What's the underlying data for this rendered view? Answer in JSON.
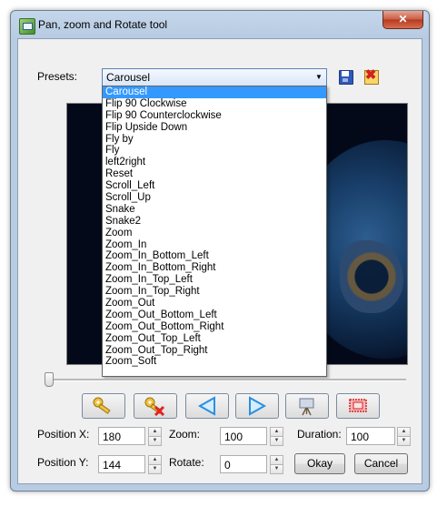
{
  "window": {
    "title": "Pan, zoom and Rotate tool",
    "close_label": "✕"
  },
  "presets": {
    "label": "Presets:",
    "selected": "Carousel",
    "save_icon": "floppy-disk-icon",
    "delete_icon": "red-x-delete-icon",
    "options": [
      "Carousel",
      "Flip 90 Clockwise",
      "Flip 90 Counterclockwise",
      "Flip Upside Down",
      "Fly by",
      "Fly",
      "left2right",
      "Reset",
      "Scroll_Left",
      "Scroll_Up",
      "Snake",
      "Snake2",
      "Zoom",
      "Zoom_In",
      "Zoom_In_Bottom_Left",
      "Zoom_In_Bottom_Right",
      "Zoom_In_Top_Left",
      "Zoom_In_Top_Right",
      "Zoom_Out",
      "Zoom_Out_Bottom_Left",
      "Zoom_Out_Bottom_Right",
      "Zoom_Out_Top_Left",
      "Zoom_Out_Top_Right",
      "Zoom_Soft"
    ]
  },
  "toolbar": {
    "icons": [
      "set-key-icon",
      "delete-key-icon",
      "previous-icon",
      "next-icon",
      "preview-icon",
      "fit-frame-icon"
    ]
  },
  "form": {
    "position_x_label": "Position X:",
    "position_x": "180",
    "position_y_label": "Position Y:",
    "position_y": "144",
    "zoom_label": "Zoom:",
    "zoom": "100",
    "rotate_label": "Rotate:",
    "rotate": "0",
    "duration_label": "Duration:",
    "duration": "100"
  },
  "buttons": {
    "ok": "Okay",
    "cancel": "Cancel"
  },
  "colors": {
    "selection": "#3399ff",
    "arrow_blue": "#2a8fe0"
  }
}
